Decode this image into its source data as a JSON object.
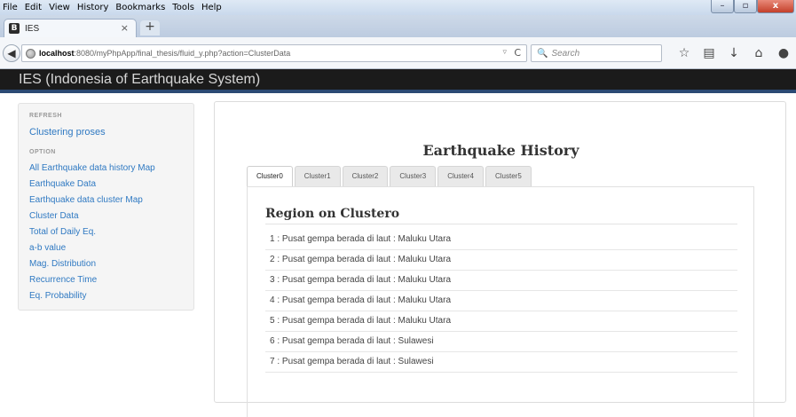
{
  "browser": {
    "menu": [
      "File",
      "Edit",
      "View",
      "History",
      "Bookmarks",
      "Tools",
      "Help"
    ],
    "tab": {
      "favicon": "B",
      "title": "IES",
      "close": "×"
    },
    "new_tab": "+",
    "url": {
      "host": "localhost",
      "path": ":8080/myPhpApp/final_thesis/fluid_y.php?action=ClusterData"
    },
    "search_placeholder": "Search",
    "toolbar_icons": [
      "star-icon",
      "bookmarks-list-icon",
      "download-icon",
      "home-icon",
      "chat-icon",
      "menu-icon"
    ]
  },
  "site": {
    "brand": "IES (Indonesia of Earthquake System)"
  },
  "sidebar": {
    "refresh_header": "REFRESH",
    "refresh_link": "Clustering proses",
    "option_header": "OPTION",
    "items": [
      "All Earthquake data history Map",
      "Earthquake Data",
      "Earthquake data cluster Map",
      "Cluster Data",
      "Total of Daily Eq.",
      "a-b value",
      "Mag. Distribution",
      "Recurrence Time",
      "Eq. Probability"
    ]
  },
  "main": {
    "title": "Earthquake History",
    "tabs": [
      "Cluster0",
      "Cluster1",
      "Cluster2",
      "Cluster3",
      "Cluster4",
      "Cluster5"
    ],
    "active_tab": 0,
    "region_heading": "Region on Clustero",
    "rows": [
      "1 : Pusat gempa berada di laut : Maluku Utara",
      "2 : Pusat gempa berada di laut : Maluku Utara",
      "3 : Pusat gempa berada di laut : Maluku Utara",
      "4 : Pusat gempa berada di laut : Maluku Utara",
      "5 : Pusat gempa berada di laut : Maluku Utara",
      "6 : Pusat gempa berada di laut : Sulawesi",
      "7 : Pusat gempa berada di laut : Sulawesi"
    ]
  },
  "colors": {
    "header_bg": "#1b1b1b",
    "header_border": "#2b4a74",
    "link": "#2f79c2"
  }
}
